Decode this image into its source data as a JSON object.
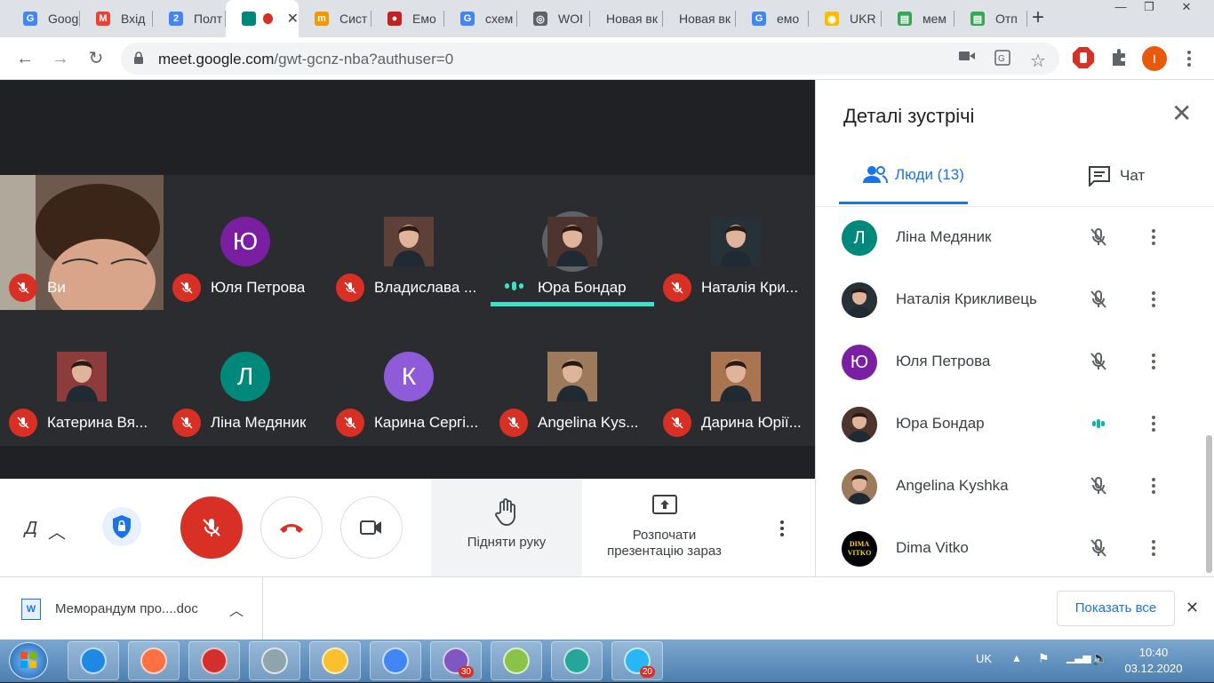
{
  "browser": {
    "tabs": [
      {
        "title": "Goog",
        "fav_color": "#4285f4",
        "fav_char": "G"
      },
      {
        "title": "Вхід",
        "fav_color": "#ea4335",
        "fav_char": "M"
      },
      {
        "title": "Полт",
        "fav_color": "#4285f4",
        "fav_char": "2"
      },
      {
        "title": "",
        "fav_color": "#00897b",
        "fav_char": "",
        "active": true
      },
      {
        "title": "Сист",
        "fav_color": "#f29900",
        "fav_char": "m"
      },
      {
        "title": "Емо",
        "fav_color": "#c5221f",
        "fav_char": "●"
      },
      {
        "title": "схем",
        "fav_color": "#4285f4",
        "fav_char": "G"
      },
      {
        "title": "WOI",
        "fav_color": "#5f6368",
        "fav_char": "◎"
      },
      {
        "title": "Новая вк",
        "fav_color": "",
        "fav_char": ""
      },
      {
        "title": "Новая вк",
        "fav_color": "",
        "fav_char": ""
      },
      {
        "title": "емо",
        "fav_color": "#4285f4",
        "fav_char": "G"
      },
      {
        "title": "UKR",
        "fav_color": "#fbbc04",
        "fav_char": "◉"
      },
      {
        "title": "мем",
        "fav_color": "#34a853",
        "fav_char": "▤"
      },
      {
        "title": "Отп",
        "fav_color": "#34a853",
        "fav_char": "▤"
      }
    ],
    "url_host": "meet.google.com",
    "url_path": "/gwt-gcnz-nba?authuser=0",
    "profile_initial": "I"
  },
  "meet": {
    "self_label": "Ви",
    "tiles": [
      {
        "name": "Юля Петрова",
        "initial": "Ю",
        "color": "#7b1fa2",
        "photo": false
      },
      {
        "name": "Владислава ...",
        "initial": "",
        "color": "#5d4037",
        "photo": true
      },
      {
        "name": "Юра Бондар",
        "initial": "",
        "color": "#4e342e",
        "photo": true,
        "speaking": true
      },
      {
        "name": "Наталія Кри...",
        "initial": "",
        "color": "#263238",
        "photo": true
      },
      {
        "name": "Катерина Вя...",
        "initial": "",
        "color": "#8d3b3b",
        "photo": true
      },
      {
        "name": "Ліна Медяник",
        "initial": "Л",
        "color": "#00897b",
        "photo": false
      },
      {
        "name": "Карина Сергі...",
        "initial": "К",
        "color": "#8e5cd9",
        "photo": false
      },
      {
        "name": "Angelina Kys...",
        "initial": "",
        "color": "#9c7a5b",
        "photo": true
      },
      {
        "name": "Дарина Юрії...",
        "initial": "",
        "color": "#a9744f",
        "photo": true
      }
    ],
    "controls": {
      "left_label": "Д",
      "raise_hand": "Підняти руку",
      "present_line1": "Розпочати",
      "present_line2": "презентацію зараз"
    }
  },
  "panel": {
    "title": "Деталі зустрічі",
    "people_tab": "Люди (13)",
    "chat_tab": "Чат",
    "people": [
      {
        "name": "Ліна Медяник",
        "initial": "Л",
        "color": "#00897b",
        "photo": false,
        "speaking": false
      },
      {
        "name": "Наталія Крикливець",
        "initial": "",
        "color": "#263238",
        "photo": true,
        "speaking": false
      },
      {
        "name": "Юля Петрова",
        "initial": "Ю",
        "color": "#7b1fa2",
        "photo": false,
        "speaking": false
      },
      {
        "name": "Юра Бондар",
        "initial": "",
        "color": "#4e342e",
        "photo": true,
        "speaking": true
      },
      {
        "name": "Angelina Kyshka",
        "initial": "",
        "color": "#9c7a5b",
        "photo": true,
        "speaking": false
      },
      {
        "name": "Dima Vitko",
        "initial": "DIMA VITKO",
        "color": "#000000",
        "photo": false,
        "speaking": false
      }
    ]
  },
  "downloads": {
    "file_name": "Меморандум про....doc",
    "show_all": "Показать все"
  },
  "taskbar": {
    "items": [
      {
        "name": "ie",
        "color": "#1e88e5",
        "badge": ""
      },
      {
        "name": "media",
        "color": "#ff7043",
        "badge": ""
      },
      {
        "name": "opera",
        "color": "#d32f2f",
        "badge": ""
      },
      {
        "name": "calculator",
        "color": "#90a4ae",
        "badge": ""
      },
      {
        "name": "explorer",
        "color": "#fbc02d",
        "badge": ""
      },
      {
        "name": "chrome",
        "color": "#4285f4",
        "badge": ""
      },
      {
        "name": "viber",
        "color": "#7e57c2",
        "badge": "30"
      },
      {
        "name": "paint",
        "color": "#8bc34a",
        "badge": ""
      },
      {
        "name": "photos",
        "color": "#26a69a",
        "badge": ""
      },
      {
        "name": "telegram",
        "color": "#29b6f6",
        "badge": "20"
      }
    ],
    "lang": "UK",
    "time": "10:40",
    "date": "03.12.2020"
  }
}
